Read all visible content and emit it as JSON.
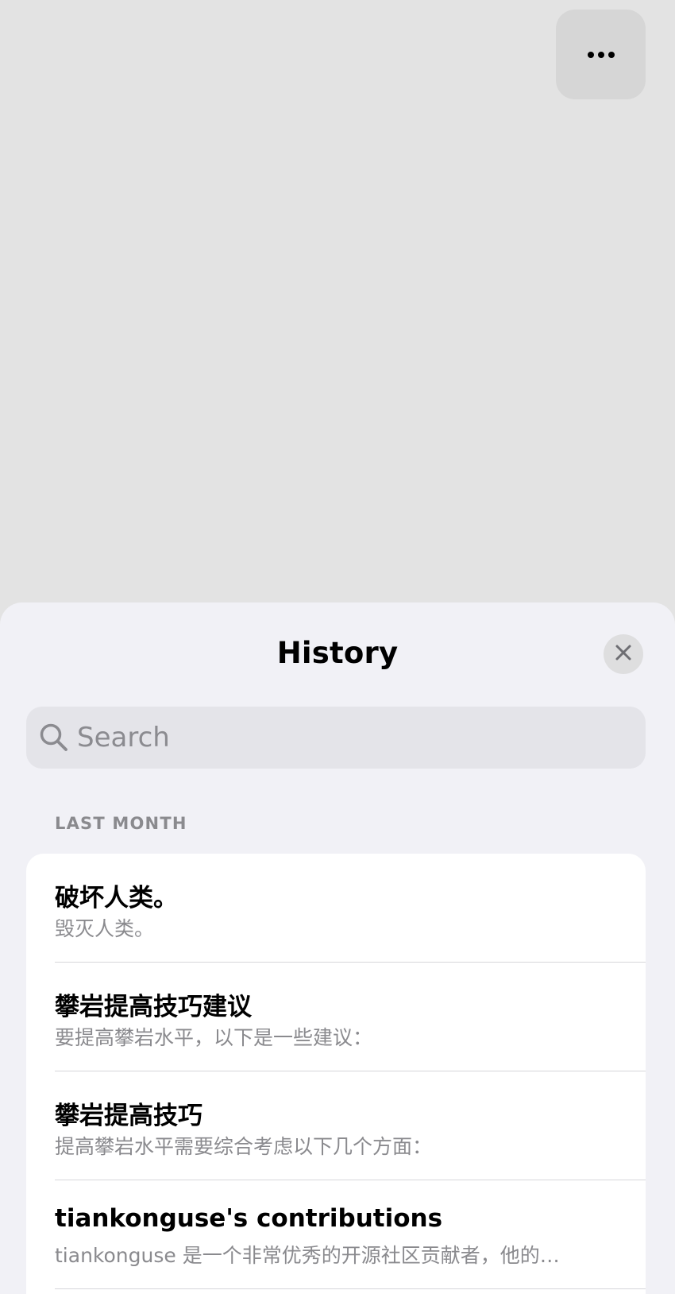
{
  "top_bar": {
    "more_icon": "ellipsis-icon"
  },
  "history_sheet": {
    "title": "History",
    "close_icon": "close-icon",
    "search": {
      "placeholder": "Search",
      "value": "",
      "icon": "magnifier-icon"
    },
    "sections": [
      {
        "header": "LAST MONTH",
        "items": [
          {
            "title": "破坏人类。",
            "subtitle": "毁灭人类。"
          },
          {
            "title": "攀岩提高技巧建议",
            "subtitle": "要提高攀岩水平，以下是一些建议："
          },
          {
            "title": "攀岩提高技巧",
            "subtitle": "提高攀岩水平需要综合考虑以下几个方面："
          },
          {
            "title": "tiankonguse's contributions",
            "subtitle": "tiankonguse 是一个非常优秀的开源社区贡献者，他的…"
          }
        ]
      }
    ]
  },
  "colors": {
    "backdrop": "#e3e3e3",
    "sheet": "#f1f1f6",
    "card": "#ffffff",
    "secondary_text": "#8a8a8e"
  }
}
